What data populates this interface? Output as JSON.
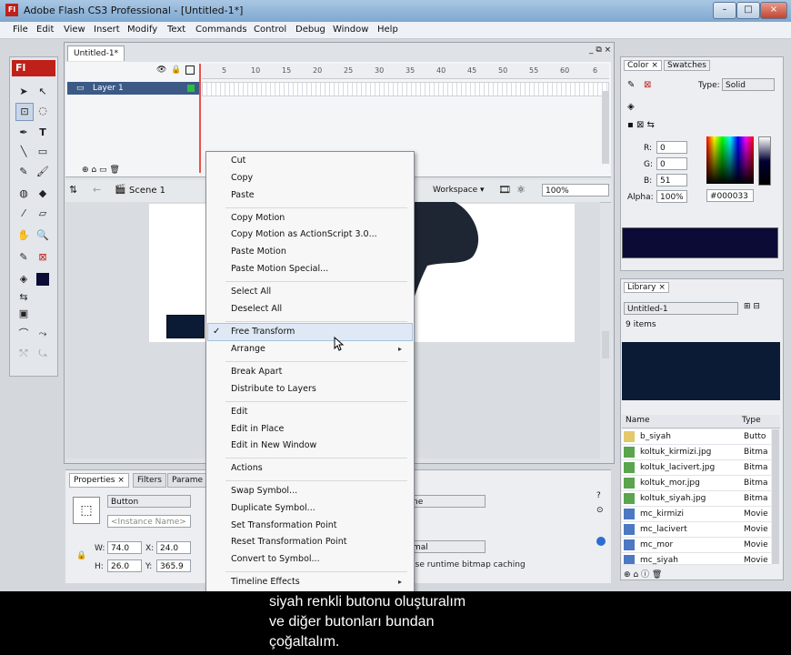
{
  "window": {
    "title": "Adobe Flash CS3 Professional - [Untitled-1*]",
    "app_icon": "Fl",
    "controls": [
      "–",
      "□",
      "×"
    ]
  },
  "menubar": [
    "File",
    "Edit",
    "View",
    "Insert",
    "Modify",
    "Text",
    "Commands",
    "Control",
    "Debug",
    "Window",
    "Help"
  ],
  "tools": {
    "badge": "Fl"
  },
  "document": {
    "tab": "Untitled-1*",
    "layer_name": "Layer 1",
    "frame_numbers": [
      "5",
      "10",
      "15",
      "20",
      "25",
      "30",
      "35",
      "40",
      "45",
      "50",
      "55",
      "60",
      "6"
    ],
    "scene": "Scene 1",
    "workspace": "Workspace ▾",
    "zoom": "100%"
  },
  "context_menu": {
    "items": [
      {
        "label": "Cut",
        "enabled": true
      },
      {
        "label": "Copy",
        "enabled": true
      },
      {
        "label": "Paste",
        "enabled": true
      },
      {
        "label": "Copy Motion",
        "enabled": true
      },
      {
        "label": "Copy Motion as ActionScript 3.0...",
        "enabled": true
      },
      {
        "label": "Paste Motion",
        "enabled": true
      },
      {
        "label": "Paste Motion Special...",
        "enabled": true
      },
      {
        "label": "Select All",
        "enabled": true
      },
      {
        "label": "Deselect All",
        "enabled": true
      },
      {
        "label": "Free Transform",
        "checked": true,
        "highlighted": true
      },
      {
        "label": "Arrange",
        "submenu": true
      },
      {
        "label": "Break Apart",
        "enabled": true
      },
      {
        "label": "Distribute to Layers",
        "enabled": true
      },
      {
        "label": "Edit",
        "enabled": true
      },
      {
        "label": "Edit in Place",
        "enabled": true
      },
      {
        "label": "Edit in New Window",
        "enabled": true
      },
      {
        "label": "Actions",
        "enabled": true
      },
      {
        "label": "Swap Symbol...",
        "enabled": true
      },
      {
        "label": "Duplicate Symbol...",
        "enabled": true
      },
      {
        "label": "Set Transformation Point",
        "enabled": true
      },
      {
        "label": "Reset Transformation Point",
        "enabled": true
      },
      {
        "label": "Convert to Symbol...",
        "enabled": true
      },
      {
        "label": "Timeline Effects",
        "submenu": true
      }
    ],
    "check_mark": "✓",
    "submenu_arrow": "▸"
  },
  "properties": {
    "tabs": [
      "Properties ×",
      "Filters",
      "Parame"
    ],
    "symbol_type": "Button",
    "instance_placeholder": "<Instance Name>",
    "w_label": "W:",
    "w_value": "74.0",
    "h_label": "H:",
    "h_value": "26.0",
    "x_label": "X:",
    "x_value": "24.0",
    "y_label": "Y:",
    "y_value": "365.9",
    "blend_suffix": "ne",
    "blend_mode_suffix": "mal",
    "cache_text": "Jse runtime bitmap caching"
  },
  "color_panel": {
    "tabs": [
      "Color ×",
      "Swatches"
    ],
    "type_label": "Type:",
    "type_value": "Solid",
    "r_label": "R:",
    "r_value": "0",
    "g_label": "G:",
    "g_value": "0",
    "b_label": "B:",
    "b_value": "51",
    "alpha_label": "Alpha:",
    "alpha_value": "100%",
    "hex": "#000033",
    "swatch_color": "#0b0b36"
  },
  "library_panel": {
    "tab": "Library ×",
    "doc": "Untitled-1",
    "count": "9 items",
    "col_name": "Name",
    "col_type": "Type",
    "rows": [
      {
        "name": "b_siyah",
        "type": "Butto",
        "icon": "button-symbol-icon"
      },
      {
        "name": "koltuk_kirmizi.jpg",
        "type": "Bitma",
        "icon": "bitmap-icon"
      },
      {
        "name": "koltuk_lacivert.jpg",
        "type": "Bitma",
        "icon": "bitmap-icon"
      },
      {
        "name": "koltuk_mor.jpg",
        "type": "Bitma",
        "icon": "bitmap-icon"
      },
      {
        "name": "koltuk_siyah.jpg",
        "type": "Bitma",
        "icon": "bitmap-icon"
      },
      {
        "name": "mc_kirmizi",
        "type": "Movie",
        "icon": "movieclip-icon"
      },
      {
        "name": "mc_lacivert",
        "type": "Movie",
        "icon": "movieclip-icon"
      },
      {
        "name": "mc_mor",
        "type": "Movie",
        "icon": "movieclip-icon"
      },
      {
        "name": "mc_siyah",
        "type": "Movie",
        "icon": "movieclip-icon"
      }
    ]
  },
  "subtitle": {
    "lines": [
      "siyah renkli butonu oluşturalım",
      "ve diğer butonları bundan",
      "çoğaltalım."
    ]
  }
}
